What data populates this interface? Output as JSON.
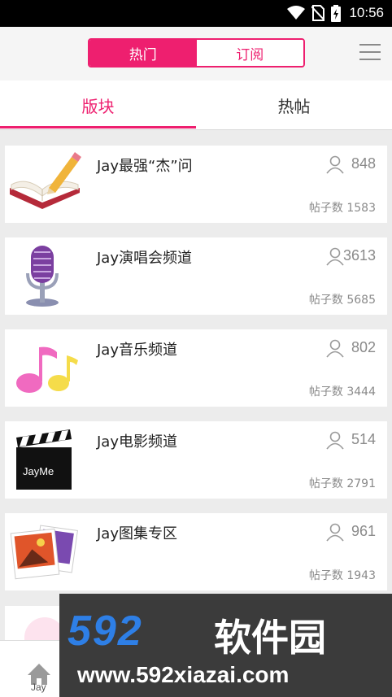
{
  "status_bar": {
    "time": "10:56",
    "icons": [
      "wifi-icon",
      "no-sim-icon",
      "battery-charging-icon"
    ]
  },
  "header": {
    "segment_tabs": [
      {
        "label": "热门",
        "active": true
      },
      {
        "label": "订阅",
        "active": false
      }
    ],
    "menu_icon": "hamburger-menu-icon"
  },
  "sub_tabs": [
    {
      "label": "版块",
      "active": true
    },
    {
      "label": "热帖",
      "active": false
    }
  ],
  "forums": [
    {
      "title": "Jay最强“杰”问",
      "members": "848",
      "post_count_label": "帖子数 1583",
      "icon": "book-pencil-icon"
    },
    {
      "title": "Jay演唱会频道",
      "members": "3613",
      "post_count_label": "帖子数 5685",
      "icon": "microphone-icon"
    },
    {
      "title": "Jay音乐频道",
      "members": "802",
      "post_count_label": "帖子数 3444",
      "icon": "music-note-icon"
    },
    {
      "title": "Jay电影频道",
      "members": "514",
      "post_count_label": "帖子数 2791",
      "icon": "clapperboard-icon",
      "icon_text": "JayMe"
    },
    {
      "title": "Jay图集专区",
      "members": "961",
      "post_count_label": "帖子数 1943",
      "icon": "photo-album-icon"
    }
  ],
  "bottom_nav": {
    "home_label": "Jay",
    "home_icon": "home-icon"
  },
  "watermark": {
    "brand": "592",
    "brand_cn": "软件园",
    "url": "www.592xiazai.com"
  },
  "colors": {
    "accent": "#ee1f6f",
    "text_primary": "#222222",
    "text_secondary": "#8a8a8a",
    "background": "#ececec"
  }
}
